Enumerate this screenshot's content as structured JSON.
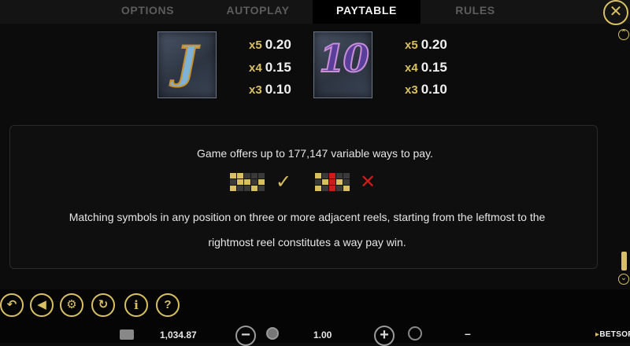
{
  "tabs": [
    {
      "label": "OPTIONS",
      "active": false
    },
    {
      "label": "AUTOPLAY",
      "active": false
    },
    {
      "label": "PAYTABLE",
      "active": true
    },
    {
      "label": "RULES",
      "active": false
    }
  ],
  "close_icon": "✕",
  "symbols": [
    {
      "glyph": "J",
      "payouts": [
        {
          "mult": "x5",
          "value": "0.20"
        },
        {
          "mult": "x4",
          "value": "0.15"
        },
        {
          "mult": "x3",
          "value": "0.10"
        }
      ]
    },
    {
      "glyph": "10",
      "payouts": [
        {
          "mult": "x5",
          "value": "0.20"
        },
        {
          "mult": "x4",
          "value": "0.15"
        },
        {
          "mult": "x3",
          "value": "0.10"
        }
      ]
    }
  ],
  "info": {
    "title": "Game offers up to 177,147 variable ways to pay.",
    "body_line1": "Matching symbols in any position on three or more adjacent reels, starting from the leftmost to the",
    "body_line2": "rightmost reel constitutes a way pay win.",
    "valid_icon": "✓",
    "invalid_icon": "✕"
  },
  "toolbar": {
    "buttons": [
      "back",
      "rewind",
      "settings",
      "sound",
      "info",
      "help"
    ],
    "glyphs": {
      "back": "↶",
      "rewind": "◀",
      "settings": "⚙",
      "sound": "↻",
      "info": "i",
      "help": "?"
    }
  },
  "bottom": {
    "balance": "1,034.87",
    "bet": "1.00",
    "win": "–",
    "minus": "−",
    "plus": "+",
    "brand": "BETSOFT",
    "brand_prefix": "▸",
    "brand_mark": "B"
  },
  "colors": {
    "accent": "#d8c062",
    "cross": "#d11b1b",
    "background": "#0c0c0c"
  }
}
